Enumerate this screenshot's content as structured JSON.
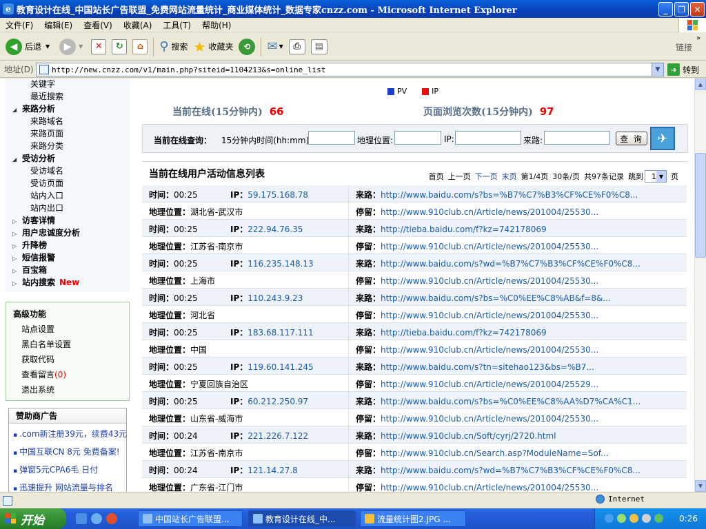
{
  "window": {
    "title": "教育设计在线_中国站长广告联盟_免费网站流量统计_商业媒体统计_数据专家cnzz.com - Microsoft Internet Explorer",
    "app_icon_glyph": "e",
    "minimize": "_",
    "maximize": "❐",
    "close": "✕"
  },
  "menu": [
    "文件(F)",
    "编辑(E)",
    "查看(V)",
    "收藏(A)",
    "工具(T)",
    "帮助(H)"
  ],
  "toolbar": {
    "back": "后退",
    "search": "搜索",
    "favorites": "收藏夹",
    "links": "链接"
  },
  "address": {
    "label": "地址(D)",
    "url": "http://new.cnzz.com/v1/main.php?siteid=1104213&s=online_list",
    "go": "转到"
  },
  "sidebar": {
    "tree": [
      {
        "label": "关键字",
        "level": 2
      },
      {
        "label": "最近搜索",
        "level": 2
      },
      {
        "label": "来路分析",
        "level": 1,
        "expanded": true
      },
      {
        "label": "来路域名",
        "level": 2
      },
      {
        "label": "来路页面",
        "level": 2
      },
      {
        "label": "来路分类",
        "level": 2
      },
      {
        "label": "受访分析",
        "level": 1,
        "expanded": true
      },
      {
        "label": "受访域名",
        "level": 2
      },
      {
        "label": "受访页面",
        "level": 2
      },
      {
        "label": "站内入口",
        "level": 2
      },
      {
        "label": "站内出口",
        "level": 2
      },
      {
        "label": "访客详情",
        "level": 1,
        "expanded": false
      },
      {
        "label": "用户忠诚度分析",
        "level": 1,
        "expanded": false
      },
      {
        "label": "升降榜",
        "level": 1,
        "expanded": false
      },
      {
        "label": "短信报警",
        "level": 1,
        "expanded": false
      },
      {
        "label": "百宝箱",
        "level": 1,
        "expanded": false
      },
      {
        "label": "站内搜索",
        "level": 1,
        "expanded": false,
        "badge": "New"
      }
    ],
    "advanced": {
      "title": "高级功能",
      "items": [
        "站点设置",
        "黑白名单设置",
        "获取代码",
        "查看留言",
        "退出系统"
      ],
      "message_count": "(0)"
    },
    "sponsor": {
      "title": "赞助商广告",
      "ads": [
        ".com新注册39元，续费43元",
        "中国互联CN 8元 免费备案!",
        "弹窗5元CPA6毛 日付",
        "迅速提升 网站流量与排名"
      ]
    }
  },
  "main": {
    "legend": [
      {
        "label": "PV",
        "color": "#1a3fc8"
      },
      {
        "label": "IP",
        "color": "#e81010"
      }
    ],
    "online_label": "当前在线(15分钟内)",
    "online_count": "66",
    "pv_label": "页面浏览次数(15分钟内)",
    "pv_count": "97",
    "query": {
      "title": "当前在线查询：",
      "time_label": "15分钟内时间(hh:mm):",
      "geo_label": "地理位置:",
      "ip_label": "IP:",
      "ref_label": "来路:",
      "button": "查 询"
    },
    "list_title": "当前在线用户活动信息列表",
    "pager": {
      "first": "首页",
      "prev": "上一页",
      "next": "下一页",
      "last": "末页",
      "page_info": "第1/4页",
      "per_page": "30条/页",
      "total": "共97条记录",
      "jump": "跳到",
      "page_value": "1",
      "page_unit": "页"
    },
    "labels": {
      "time": "时间：",
      "ip": "IP：",
      "ref": "来路：",
      "geo": "地理位置：",
      "stay": "停留："
    },
    "records": [
      {
        "time": "00:25",
        "ip": "59.175.168.78",
        "ref": "http://www.baidu.com/s?bs=%B7%C7%B3%CF%CE%F0%C8...",
        "geo": "湖北省-武汉市",
        "stay": "http://www.910club.cn/Article/news/201004/25530..."
      },
      {
        "time": "00:25",
        "ip": "222.94.76.35",
        "ref": "http://tieba.baidu.com/f?kz=742178069",
        "geo": "江苏省-南京市",
        "stay": "http://www.910club.cn/Article/news/201004/25530..."
      },
      {
        "time": "00:25",
        "ip": "116.235.148.13",
        "ref": "http://www.baidu.com/s?wd=%B7%C7%B3%CF%CE%F0%C8...",
        "geo": "上海市",
        "stay": "http://www.910club.cn/Article/news/201004/25530..."
      },
      {
        "time": "00:25",
        "ip": "110.243.9.23",
        "ref": "http://www.baidu.com/s?bs=%C0%EE%C8%AB&f=8&...",
        "geo": "河北省",
        "stay": "http://www.910club.cn/Article/news/201004/25530..."
      },
      {
        "time": "00:25",
        "ip": "183.68.117.111",
        "ref": "http://tieba.baidu.com/f?kz=742178069",
        "geo": "中国",
        "stay": "http://www.910club.cn/Article/news/201004/25530..."
      },
      {
        "time": "00:25",
        "ip": "119.60.141.245",
        "ref": "http://www.baidu.com/s?tn=sitehao123&bs=%B7...",
        "geo": "宁夏回族自治区",
        "stay": "http://www.910club.cn/Article/news/201004/25529..."
      },
      {
        "time": "00:25",
        "ip": "60.212.250.97",
        "ref": "http://www.baidu.com/s?bs=%C0%EE%C8%AA%D7%CA%C1...",
        "geo": "山东省-威海市",
        "stay": "http://www.910club.cn/Article/news/201004/25530..."
      },
      {
        "time": "00:24",
        "ip": "221.226.7.122",
        "ref": "http://www.910club.cn/Soft/cyrj/2720.html",
        "geo": "江苏省-南京市",
        "stay": "http://www.910club.cn/Search.asp?ModuleName=Sof..."
      },
      {
        "time": "00:24",
        "ip": "121.14.27.8",
        "ref": "http://www.baidu.com/s?wd=%B7%C7%B3%CF%CE%F0%C8...",
        "geo": "广东省-江门市",
        "stay": "http://www.910club.cn/Article/news/201004/25530..."
      }
    ]
  },
  "statusbar": {
    "zone": "Internet"
  },
  "taskbar": {
    "start": "开始",
    "tasks": [
      "中国站长广告联盟...",
      "教育设计在线_中...",
      "流量统计图2.JPG ..."
    ],
    "clock": "0:26"
  }
}
